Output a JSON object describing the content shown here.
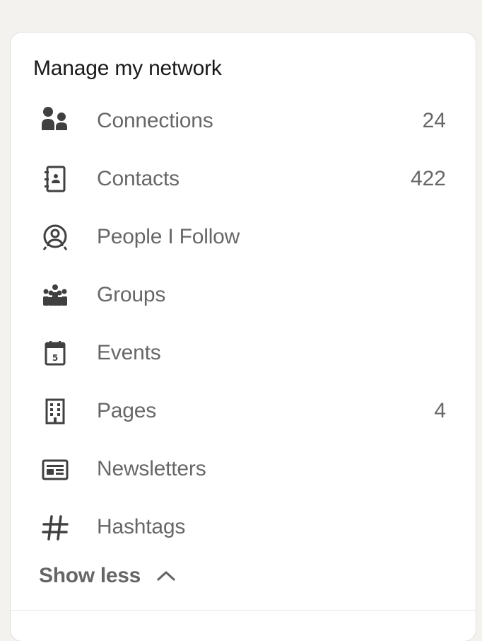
{
  "card": {
    "title": "Manage my network"
  },
  "items": [
    {
      "label": "Connections",
      "count": "24",
      "icon": "connections-icon"
    },
    {
      "label": "Contacts",
      "count": "422",
      "icon": "contacts-icon"
    },
    {
      "label": "People I Follow",
      "count": "",
      "icon": "people-follow-icon"
    },
    {
      "label": "Groups",
      "count": "",
      "icon": "groups-icon"
    },
    {
      "label": "Events",
      "count": "",
      "icon": "calendar-icon"
    },
    {
      "label": "Pages",
      "count": "4",
      "icon": "building-icon"
    },
    {
      "label": "Newsletters",
      "count": "",
      "icon": "newsletter-icon"
    },
    {
      "label": "Hashtags",
      "count": "",
      "icon": "hashtag-icon"
    }
  ],
  "show_less": {
    "label": "Show less",
    "icon": "chevron-up-icon"
  },
  "events_icon_day": "5",
  "colors": {
    "page_bg": "#f3f2ef",
    "card_bg": "#ffffff",
    "icon": "#404040",
    "muted_text": "rgba(0,0,0,0.6)"
  }
}
